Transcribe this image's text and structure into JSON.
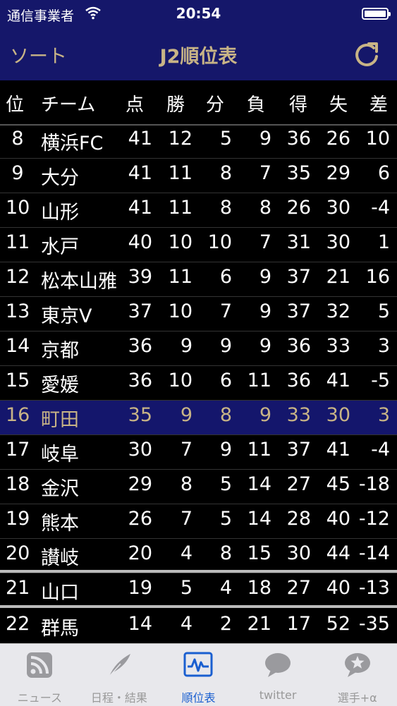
{
  "status": {
    "carrier": "通信事業者",
    "time": "20:54"
  },
  "nav": {
    "sort_label": "ソート",
    "title": "J2順位表"
  },
  "header": {
    "pos": "位",
    "team": "チーム",
    "pts": "点",
    "w": "勝",
    "d": "分",
    "l": "負",
    "gf": "得",
    "ga": "失",
    "gd": "差"
  },
  "rows": [
    {
      "pos": "8",
      "team": "横浜FC",
      "pts": "41",
      "w": "12",
      "d": "5",
      "l": "9",
      "gf": "36",
      "ga": "26",
      "gd": "10"
    },
    {
      "pos": "9",
      "team": "大分",
      "pts": "41",
      "w": "11",
      "d": "8",
      "l": "7",
      "gf": "35",
      "ga": "29",
      "gd": "6"
    },
    {
      "pos": "10",
      "team": "山形",
      "pts": "41",
      "w": "11",
      "d": "8",
      "l": "8",
      "gf": "26",
      "ga": "30",
      "gd": "-4"
    },
    {
      "pos": "11",
      "team": "水戸",
      "pts": "40",
      "w": "10",
      "d": "10",
      "l": "7",
      "gf": "31",
      "ga": "30",
      "gd": "1"
    },
    {
      "pos": "12",
      "team": "松本山雅",
      "pts": "39",
      "w": "11",
      "d": "6",
      "l": "9",
      "gf": "37",
      "ga": "21",
      "gd": "16"
    },
    {
      "pos": "13",
      "team": "東京V",
      "pts": "37",
      "w": "10",
      "d": "7",
      "l": "9",
      "gf": "37",
      "ga": "32",
      "gd": "5"
    },
    {
      "pos": "14",
      "team": "京都",
      "pts": "36",
      "w": "9",
      "d": "9",
      "l": "9",
      "gf": "36",
      "ga": "33",
      "gd": "3"
    },
    {
      "pos": "15",
      "team": "愛媛",
      "pts": "36",
      "w": "10",
      "d": "6",
      "l": "11",
      "gf": "36",
      "ga": "41",
      "gd": "-5"
    },
    {
      "pos": "16",
      "team": "町田",
      "pts": "35",
      "w": "9",
      "d": "8",
      "l": "9",
      "gf": "33",
      "ga": "30",
      "gd": "3"
    },
    {
      "pos": "17",
      "team": "岐阜",
      "pts": "30",
      "w": "7",
      "d": "9",
      "l": "11",
      "gf": "37",
      "ga": "41",
      "gd": "-4"
    },
    {
      "pos": "18",
      "team": "金沢",
      "pts": "29",
      "w": "8",
      "d": "5",
      "l": "14",
      "gf": "27",
      "ga": "45",
      "gd": "-18"
    },
    {
      "pos": "19",
      "team": "熊本",
      "pts": "26",
      "w": "7",
      "d": "5",
      "l": "14",
      "gf": "28",
      "ga": "40",
      "gd": "-12"
    },
    {
      "pos": "20",
      "team": "讃岐",
      "pts": "20",
      "w": "4",
      "d": "8",
      "l": "15",
      "gf": "30",
      "ga": "44",
      "gd": "-14"
    },
    {
      "pos": "21",
      "team": "山口",
      "pts": "19",
      "w": "5",
      "d": "4",
      "l": "18",
      "gf": "27",
      "ga": "40",
      "gd": "-13"
    },
    {
      "pos": "22",
      "team": "群馬",
      "pts": "14",
      "w": "4",
      "d": "2",
      "l": "21",
      "gf": "17",
      "ga": "52",
      "gd": "-35"
    }
  ],
  "tabs": [
    {
      "label": "ニュース",
      "icon": "rss-icon"
    },
    {
      "label": "日程・結果",
      "icon": "feather-icon"
    },
    {
      "label": "順位表",
      "icon": "chart-icon"
    },
    {
      "label": "twitter",
      "icon": "speech-bubble-icon"
    },
    {
      "label": "選手+α",
      "icon": "star-bubble-icon"
    }
  ],
  "colors": {
    "navy": "#15176a",
    "gold": "#c8b486",
    "highlight_row": "#14166c",
    "active_tab": "#1a5fd0"
  }
}
